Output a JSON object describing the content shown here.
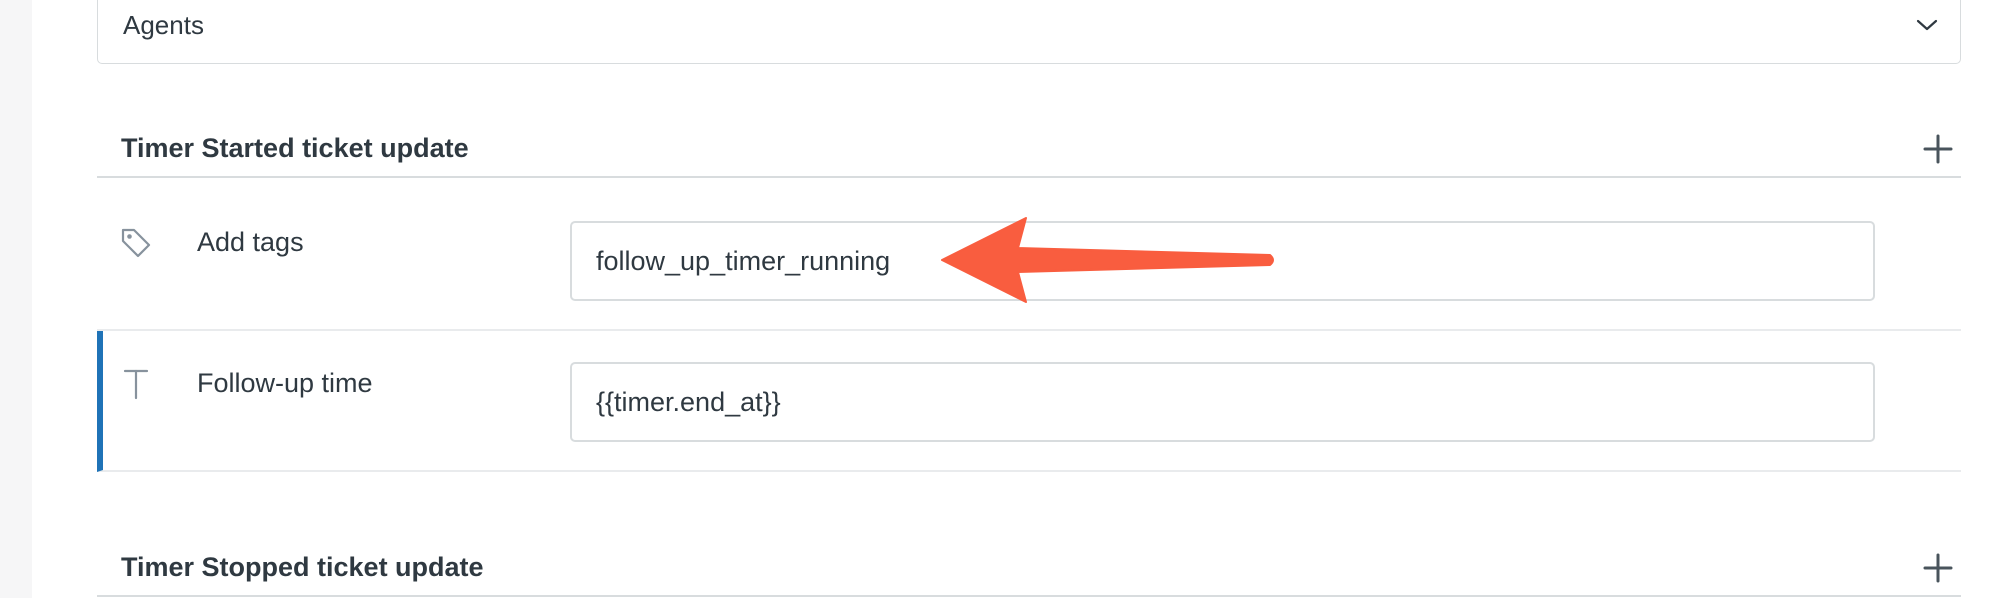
{
  "group_select": {
    "value": "Agents",
    "icon": "chevron-down-icon"
  },
  "sections": {
    "started": {
      "title": "Timer Started ticket update",
      "add_icon": "plus-icon"
    },
    "stopped": {
      "title": "Timer Stopped ticket update",
      "add_icon": "plus-icon"
    }
  },
  "rows": {
    "tags": {
      "icon": "tag-icon",
      "label": "Add tags",
      "value": "follow_up_timer_running"
    },
    "follow_up": {
      "icon": "text-field-icon",
      "label": "Follow-up time",
      "value": "{{timer.end_at}}"
    }
  },
  "annotation": {
    "icon": "arrow-left-icon",
    "color": "#f95d3f"
  },
  "colors": {
    "accent": "#1f73b7",
    "border": "#d8dcde",
    "text": "#2f3941"
  }
}
